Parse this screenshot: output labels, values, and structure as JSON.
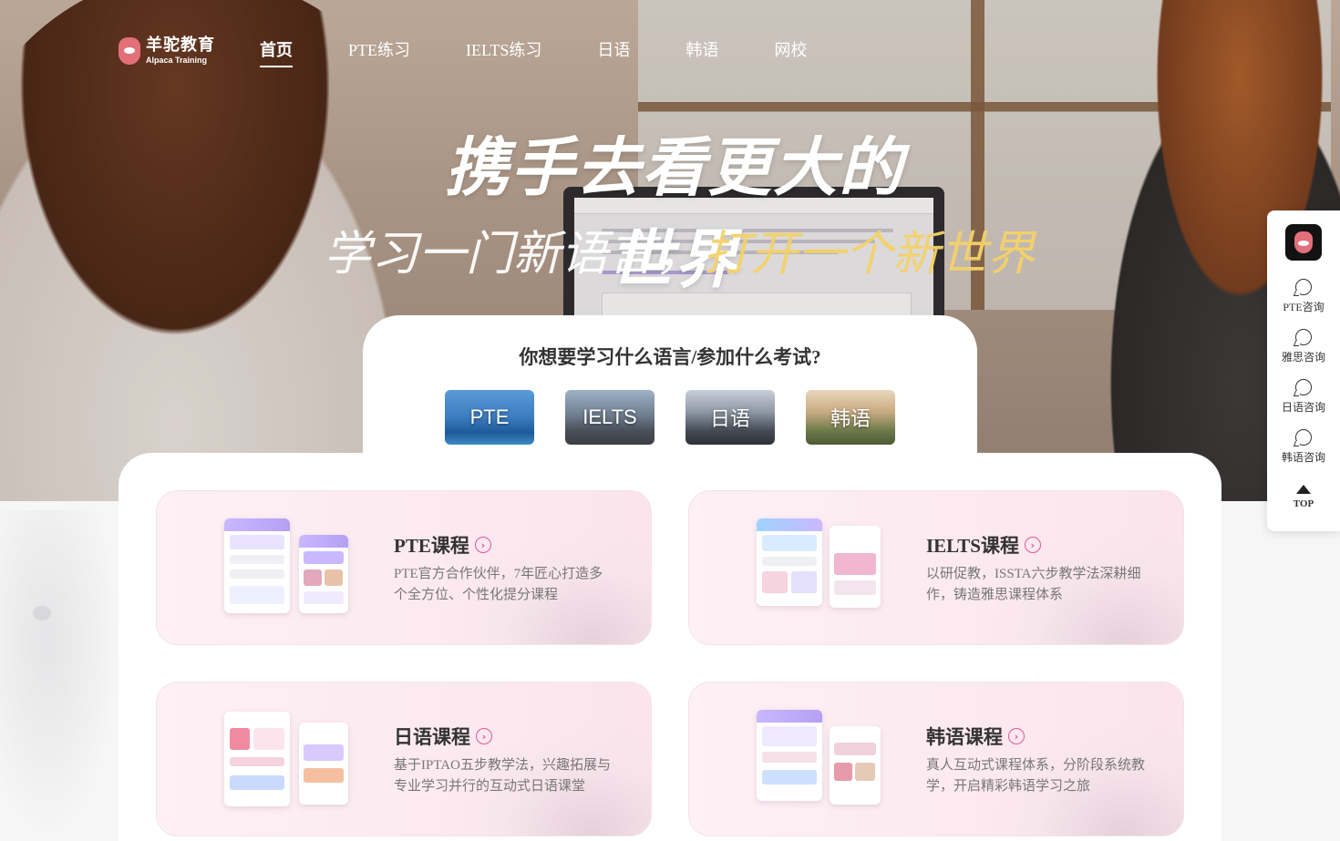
{
  "brand": {
    "name_cn": "羊驼教育",
    "name_en": "Alpaca Training"
  },
  "nav": [
    {
      "label": "首页",
      "active": true
    },
    {
      "label": "PTE练习",
      "active": false
    },
    {
      "label": "IELTS练习",
      "active": false
    },
    {
      "label": "日语",
      "active": false
    },
    {
      "label": "韩语",
      "active": false
    },
    {
      "label": "网校",
      "active": false
    }
  ],
  "hero": {
    "slogan_main": "携手去看更大的世界",
    "slogan_sub_white": "学习一门新语言，",
    "slogan_sub_yellow": "打开一个新世界"
  },
  "picker": {
    "title": "你想要学习什么语言/参加什么考试?",
    "options": [
      "PTE",
      "IELTS",
      "日语",
      "韩语"
    ]
  },
  "courses": [
    {
      "title": "PTE课程",
      "desc": "PTE官方合作伙伴，7年匠心打造多个全方位、个性化提分课程"
    },
    {
      "title": "IELTS课程",
      "desc": "以研促教，ISSTA六步教学法深耕细作，铸造雅思课程体系"
    },
    {
      "title": "日语课程",
      "desc": "基于IPTAO五步教学法，兴趣拓展与专业学习并行的互动式日语课堂"
    },
    {
      "title": "韩语课程",
      "desc": "真人互动式课程体系，分阶段系统教学，开启精彩韩语学习之旅"
    }
  ],
  "sidebar": {
    "items": [
      "PTE咨询",
      "雅思咨询",
      "日语咨询",
      "韩语咨询"
    ],
    "top_label": "TOP"
  },
  "colors": {
    "accent": "#e2569a",
    "highlight": "#f4d26a"
  }
}
